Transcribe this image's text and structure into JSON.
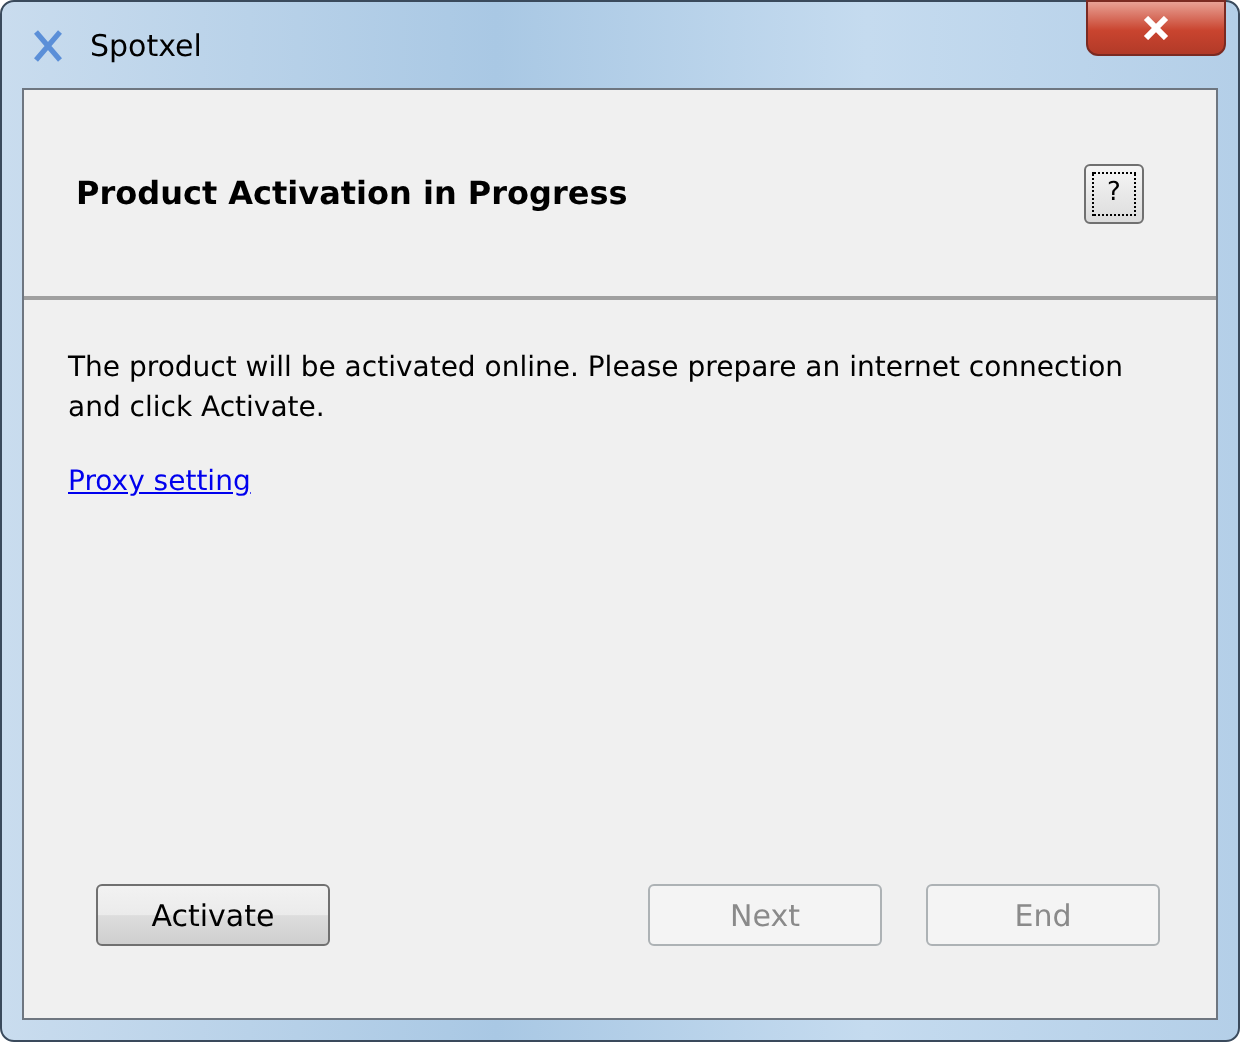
{
  "window": {
    "title": "Spotxel"
  },
  "header": {
    "title": "Product Activation in Progress",
    "help": "?"
  },
  "message": "The product will be activated online. Please prepare an internet connection and click Activate.",
  "link": "Proxy setting",
  "buttons": [
    {
      "label": "Activate",
      "disabled": false
    },
    {
      "label": "Next",
      "disabled": true
    },
    {
      "label": "End",
      "disabled": true
    }
  ]
}
